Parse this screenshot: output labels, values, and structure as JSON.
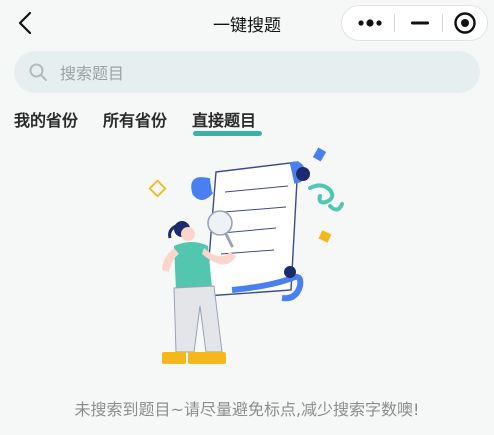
{
  "nav": {
    "title": "一键搜题",
    "back_icon": "chevron-left-icon",
    "capsule": {
      "more_icon": "more-dots-icon",
      "minimize_icon": "minus-icon",
      "close_icon": "target-circle-icon"
    }
  },
  "search": {
    "placeholder": "搜索题目",
    "value": "",
    "icon": "search-icon"
  },
  "tabs": [
    {
      "label": "我的省份",
      "active": false
    },
    {
      "label": "所有省份",
      "active": false
    },
    {
      "label": "直接题目",
      "active": true
    }
  ],
  "colors": {
    "accent": "#3cb2a6",
    "search_bg": "#e5efef",
    "page_bg": "#f6f8f7"
  },
  "empty_state": {
    "illustration": "person-with-magnifier-document-illustration",
    "message": "未搜索到题目~请尽量避免标点,减少搜索字数噢!"
  }
}
